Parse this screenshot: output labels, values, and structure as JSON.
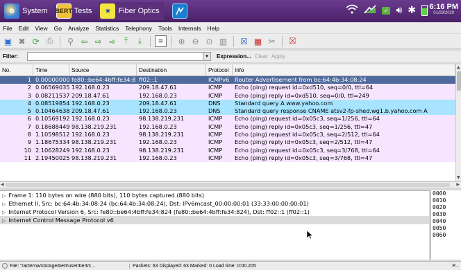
{
  "system_bar": {
    "system_label": "System",
    "tests_label": "Tests",
    "tests_icon_text": "BERT",
    "fiber_label": "Fiber Optics",
    "time": "6:16 PM",
    "date": "01/29/2020",
    "icons": [
      "wifi-icon",
      "signal-icon",
      "battery-status-icon",
      "volume-icon",
      "bluetooth-icon",
      "battery-icon"
    ]
  },
  "menu": [
    "File",
    "Edit",
    "View",
    "Go",
    "Analyze",
    "Statistics",
    "Telephony",
    "Tools",
    "Internals",
    "Help"
  ],
  "filter": {
    "label": "Filter:",
    "value": "",
    "expression": "Expression...",
    "clear": "Clear",
    "apply": "Apply"
  },
  "packet_list": {
    "columns": [
      "No.",
      "Time",
      "Source",
      "Destination",
      "Protocol",
      "Info"
    ],
    "rows": [
      {
        "no": "1",
        "time": "0.00000000",
        "src": "fe80::be64:4bff:fe34:8",
        "dst": "ff02::1",
        "proto": "ICMPv6",
        "info": "Router Advertisement from bc:64:4b:34:08:24"
      },
      {
        "no": "2",
        "time": "0.06569035",
        "src": "192.168.0.23",
        "dst": "209.18.47.61",
        "proto": "ICMP",
        "info": "Echo (ping) request  id=0xd510, seq=0/0, ttl=64"
      },
      {
        "no": "3",
        "time": "0.08211537",
        "src": "209.18.47.61",
        "dst": "192.168.0.23",
        "proto": "ICMP",
        "info": "Echo (ping) reply    id=0xd510, seq=0/0, ttl=249"
      },
      {
        "no": "4",
        "time": "0.08519854",
        "src": "192.168.0.23",
        "dst": "209.18.47.61",
        "proto": "DNS",
        "info": "Standard query A www.yahoo.com"
      },
      {
        "no": "5",
        "time": "0.10464638",
        "src": "209.18.47.61",
        "dst": "192.168.0.23",
        "proto": "DNS",
        "info": "Standard query response CNAME atsv2-fp-shed.wg1.b.yahoo.com A"
      },
      {
        "no": "6",
        "time": "0.10569192",
        "src": "192.168.0.23",
        "dst": "98.138.219.231",
        "proto": "ICMP",
        "info": "Echo (ping) request  id=0x05c3, seq=1/256, ttl=64"
      },
      {
        "no": "7",
        "time": "0.18688449",
        "src": "98.138.219.231",
        "dst": "192.168.0.23",
        "proto": "ICMP",
        "info": "Echo (ping) reply    id=0x05c3, seq=1/256, ttl=47"
      },
      {
        "no": "8",
        "time": "1.10598512",
        "src": "192.168.0.23",
        "dst": "98.138.219.231",
        "proto": "ICMP",
        "info": "Echo (ping) request  id=0x05c3, seq=2/512, ttl=64"
      },
      {
        "no": "9",
        "time": "1.18675334",
        "src": "98.138.219.231",
        "dst": "192.168.0.23",
        "proto": "ICMP",
        "info": "Echo (ping) reply    id=0x05c3, seq=2/512, ttl=47"
      },
      {
        "no": "10",
        "time": "2.10628249",
        "src": "192.168.0.23",
        "dst": "98.138.219.231",
        "proto": "ICMP",
        "info": "Echo (ping) request  id=0x05c3, seq=3/768, ttl=64"
      },
      {
        "no": "11",
        "time": "2.19450025",
        "src": "98.138.219.231",
        "dst": "192.168.0.23",
        "proto": "ICMP",
        "info": "Echo (ping) reply    id=0x05c3, seq=3/768, ttl=47"
      }
    ]
  },
  "details": [
    "Frame 1: 110 bytes on wire (880 bits), 110 bytes captured (880 bits)",
    "Ethernet II, Src: bc:64:4b:34:08:24 (bc:64:4b:34:08:24), Dst: IPv6mcast_00:00:00:01 (33:33:00:00:00:01)",
    "Internet Protocol Version 6, Src: fe80::be64:4bff:fe34:824 (fe80::be64:4bff:fe34:824), Dst: ff02::1 (ff02::1)",
    "Internet Control Message Protocol v6"
  ],
  "hex": [
    "0000",
    "0010",
    "0020",
    "0030",
    "0040",
    "0050",
    "0060"
  ],
  "status": {
    "file": "File: \"/acterna/storage/bert/user/bert/c...",
    "packets": "Packets: 63 Displayed: 63 Marked: 0 Load time: 0:00.205",
    "profile": "P..."
  },
  "colors": {
    "sysbar": "#5a2c7a",
    "selected_row": "#4f6a9c",
    "icmp_row": "#f7e5ff",
    "dns_row": "#a8e4ff"
  }
}
